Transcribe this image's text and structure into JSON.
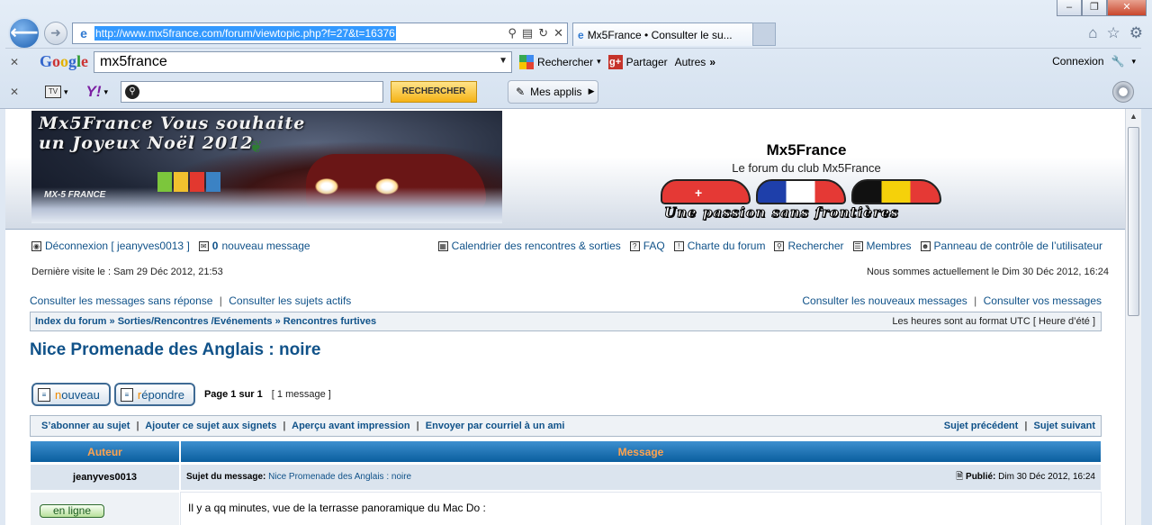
{
  "browser": {
    "url": "http://www.mx5france.com/forum/viewtopic.php?f=27&t=16376",
    "tab_title": "Mx5France • Consulter le su...",
    "toolbar_google": {
      "query": "mx5france",
      "search_label": "Rechercher",
      "share_label": "Partager",
      "more_label": "Autres",
      "login_label": "Connexion"
    },
    "toolbar_yahoo": {
      "search_button": "RECHERCHER",
      "apps_label": "Mes applis"
    }
  },
  "banner": {
    "line1": "Mx5France Vous souhaite",
    "line2": "un Joyeux Noël 2012",
    "logo": "MX-5 FRANCE"
  },
  "site": {
    "name": "Mx5France",
    "description": "Le forum du club Mx5France",
    "slogan": "Une passion sans frontières"
  },
  "user_menu": {
    "logout": "Déconnexion [ jeanyves0013 ]",
    "new_count": "0",
    "new_messages": "nouveau message",
    "calendar": "Calendrier des rencontres & sorties",
    "faq": "FAQ",
    "charter": "Charte du forum",
    "search": "Rechercher",
    "members": "Membres",
    "ucp": "Panneau de contrôle de l’utilisateur"
  },
  "last_visit": "Dernière visite le : Sam 29 Déc 2012, 21:53",
  "current_date": "Nous sommes actuellement le Dim 30 Déc 2012, 16:24",
  "quick_links": {
    "unanswered": "Consulter les messages sans réponse",
    "active": "Consulter les sujets actifs",
    "new_posts": "Consulter les nouveaux messages",
    "your_posts": "Consulter vos messages"
  },
  "breadcrumb": {
    "items": [
      "Index du forum",
      "Sorties/Rencontres /Evénements",
      "Rencontres furtives"
    ],
    "timezone": "Les heures sont au format UTC [ Heure d’été ]"
  },
  "topic": {
    "title": "Nice Promenade des Anglais : noire",
    "new_first": "n",
    "new_rest": "ouveau",
    "reply_first": "r",
    "reply_rest": "épondre",
    "page_info": "Page 1 sur 1",
    "message_count": "[ 1 message ]",
    "actions": [
      "S’abonner au sujet",
      "Ajouter ce sujet aux signets",
      "Aperçu avant impression",
      "Envoyer par courriel à un ami"
    ],
    "prev": "Sujet précédent",
    "next": "Sujet suivant"
  },
  "table": {
    "col_author": "Auteur",
    "col_message": "Message"
  },
  "post": {
    "author": "jeanyves0013",
    "subject_label": "Sujet du message:",
    "subject": "Nice Promenade des Anglais : noire",
    "posted_label": "Publié:",
    "posted_date": "Dim 30 Déc 2012, 16:24",
    "status": "en ligne",
    "body": "Il y a qq minutes, vue de la terrasse panoramique du Mac Do :"
  },
  "colors": {
    "link": "#105289",
    "header_gradient_top": "#3d8fcf",
    "header_text": "#ffa34f",
    "address_highlight": "#3399ff"
  }
}
